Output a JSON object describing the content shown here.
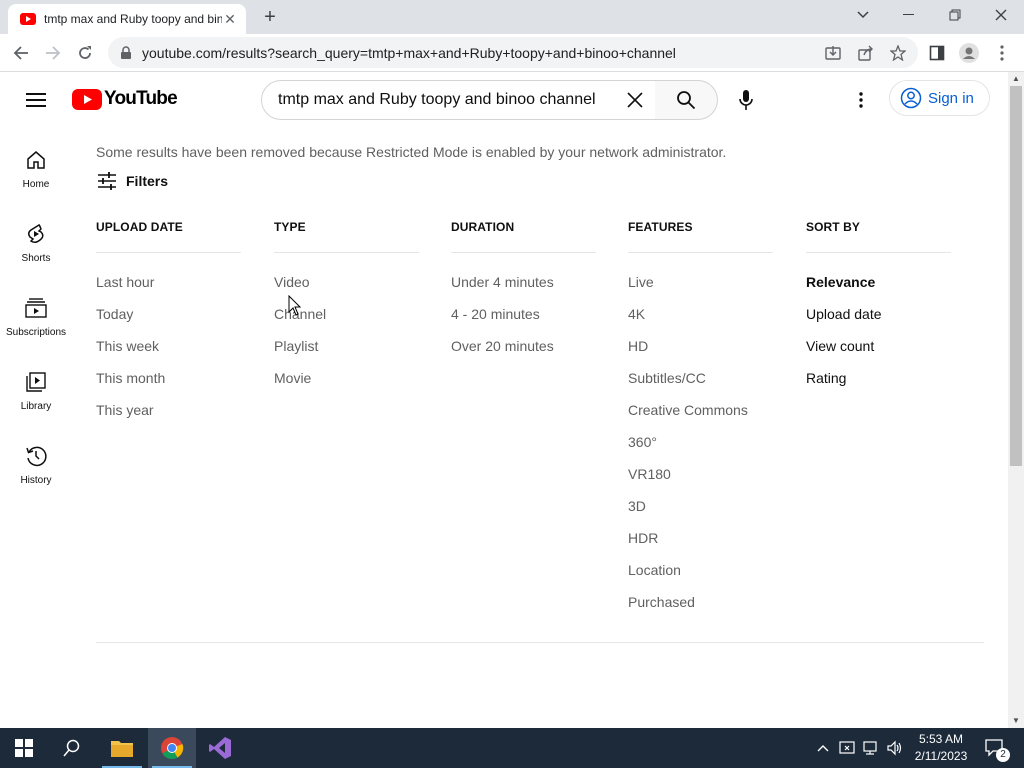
{
  "browser": {
    "tab_title": "tmtp max and Ruby toopy and binoo channel",
    "url": "youtube.com/results?search_query=tmtp+max+and+Ruby+toopy+and+binoo+channel"
  },
  "masthead": {
    "logo_text": "YouTube",
    "search_query": "tmtp max and Ruby toopy and binoo channel",
    "sign_in_label": "Sign in"
  },
  "guide": {
    "items": [
      {
        "label": "Home",
        "icon": "home-icon"
      },
      {
        "label": "Shorts",
        "icon": "shorts-icon"
      },
      {
        "label": "Subscriptions",
        "icon": "subscriptions-icon"
      },
      {
        "label": "Library",
        "icon": "library-icon"
      },
      {
        "label": "History",
        "icon": "history-icon"
      }
    ]
  },
  "content": {
    "notice": "Some results have been removed because Restricted Mode is enabled by your network administrator.",
    "filters_label": "Filters",
    "columns": [
      {
        "heading": "UPLOAD DATE",
        "options": [
          "Last hour",
          "Today",
          "This week",
          "This month",
          "This year"
        ]
      },
      {
        "heading": "TYPE",
        "options": [
          "Video",
          "Channel",
          "Playlist",
          "Movie"
        ]
      },
      {
        "heading": "DURATION",
        "options": [
          "Under 4 minutes",
          "4 - 20 minutes",
          "Over 20 minutes"
        ]
      },
      {
        "heading": "FEATURES",
        "options": [
          "Live",
          "4K",
          "HD",
          "Subtitles/CC",
          "Creative Commons",
          "360°",
          "VR180",
          "3D",
          "HDR",
          "Location",
          "Purchased"
        ]
      },
      {
        "heading": "SORT BY",
        "options": [
          "Relevance",
          "Upload date",
          "View count",
          "Rating"
        ],
        "selected": "Relevance"
      }
    ]
  },
  "taskbar": {
    "time": "5:53 AM",
    "date": "2/11/2023",
    "notification_count": "2"
  },
  "colors": {
    "yt_red": "#ff0000",
    "link_blue": "#065fd4",
    "taskbar": "#1c2a3a"
  }
}
